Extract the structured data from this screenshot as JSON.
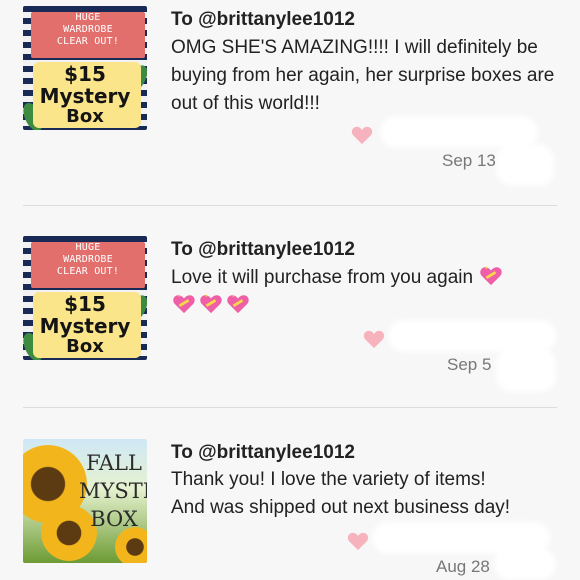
{
  "reviews": [
    {
      "to": "To @brittanylee1012",
      "message": "OMG SHE'S AMAZING!!!! I will definitely be buying from her again, her surprise boxes are out of this world!!!",
      "date": "Sep 13",
      "thumb": {
        "banner_lines": [
          "HUGE",
          "WARDROBE",
          "CLEAR OUT!"
        ],
        "price": "$15",
        "word1": "Mystery",
        "word2": "Box"
      }
    },
    {
      "to": "To @brittanylee1012",
      "message": "Love it will purchase from you again",
      "date": "Sep 5",
      "thumb": {
        "banner_lines": [
          "HUGE",
          "WARDROBE",
          "CLEAR OUT!"
        ],
        "price": "$15",
        "word1": "Mystery",
        "word2": "Box"
      }
    },
    {
      "to": "To @brittanylee1012",
      "message_line1": "Thank you! I love the variety of items!",
      "message_line2": "And was shipped out next business day!",
      "date": "Aug 28",
      "thumb": {
        "lines": [
          "FALL",
          "MYSTERY",
          "BOX"
        ]
      }
    }
  ],
  "icons": {
    "like": "heart-icon",
    "emoji": "sparkling-heart-icon"
  },
  "colors": {
    "heart": "#f7b3bd",
    "banner": "#e36f6c",
    "navy_stripe": "#1a2a57",
    "yellow": "#fbe58b"
  }
}
